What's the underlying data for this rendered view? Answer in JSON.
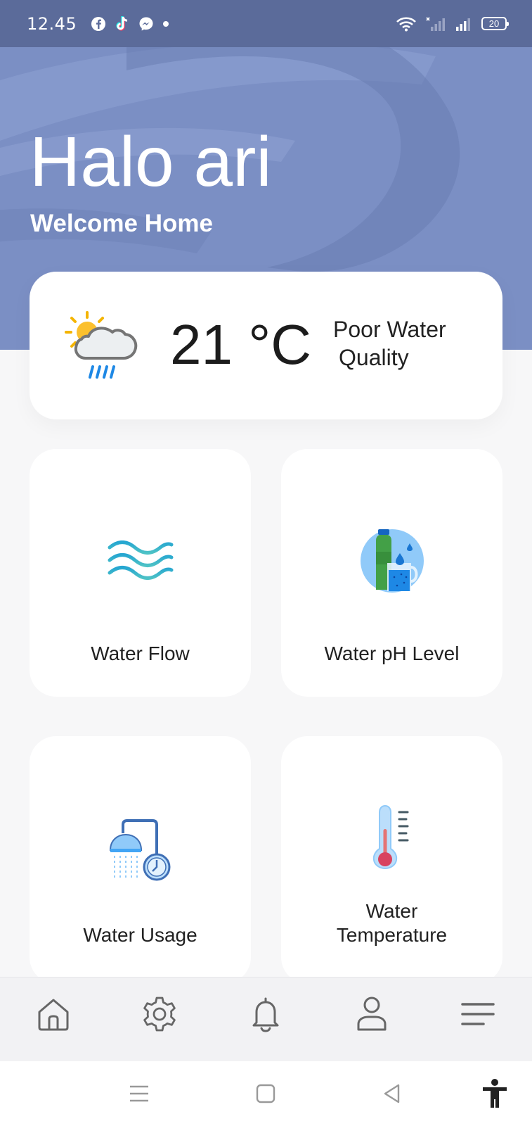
{
  "status_bar": {
    "time": "12.45",
    "battery_level": "20",
    "left_icons": [
      "facebook-icon",
      "tiktok-icon",
      "messenger-icon",
      "dot-icon"
    ],
    "right_icons": [
      "wifi-icon",
      "signal-sim1-icon",
      "signal-sim2-icon",
      "battery-icon"
    ]
  },
  "header": {
    "greeting": "Halo ari",
    "subtitle": "Welcome Home",
    "background_color": "#7b8fc4"
  },
  "weather_card": {
    "icon": "sun-cloud-rain-icon",
    "temperature": "21 °C",
    "quality_line1": "Poor Water",
    "quality_line2": "Quality"
  },
  "tiles": [
    {
      "label": "Water Flow",
      "icon": "water-waves-icon"
    },
    {
      "label": "Water pH Level",
      "icon": "water-bottle-glass-icon"
    },
    {
      "label": "Water Usage",
      "icon": "shower-clock-icon"
    },
    {
      "label_line1": "Water",
      "label_line2": "Temperature",
      "icon": "thermometer-icon"
    }
  ],
  "bottom_nav": {
    "items": [
      "home-icon",
      "settings-gear-icon",
      "notification-bell-icon",
      "profile-user-icon",
      "menu-icon"
    ]
  },
  "system_nav": {
    "items": [
      "recent-apps-icon",
      "home-square-icon",
      "back-triangle-icon",
      "accessibility-icon"
    ]
  }
}
